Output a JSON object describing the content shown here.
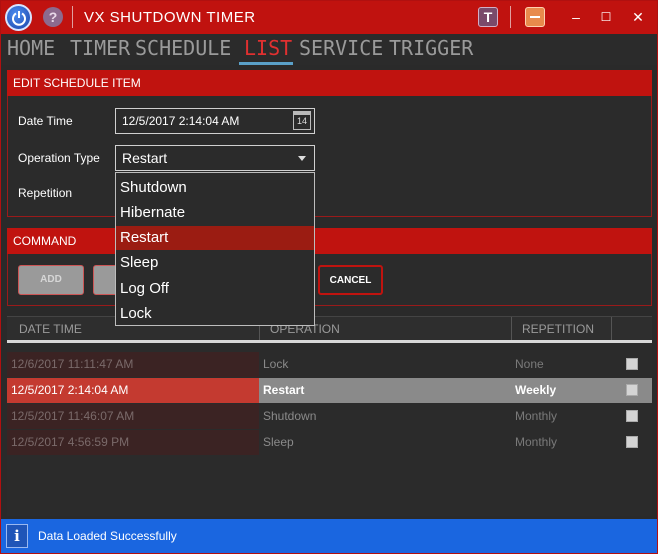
{
  "window": {
    "title": "VX SHUTDOWN TIMER"
  },
  "titlebar": {
    "help_glyph": "?",
    "t_glyph": "T",
    "minimize_glyph": "–",
    "maximize_glyph": "☐",
    "close_glyph": "✕"
  },
  "nav": {
    "items": [
      {
        "label": "HOME"
      },
      {
        "label": "TIMER"
      },
      {
        "label": "SCHEDULE"
      },
      {
        "label": "LIST",
        "active": true
      },
      {
        "label": "SERVICE"
      },
      {
        "label": "TRIGGER"
      }
    ]
  },
  "edit": {
    "heading": "EDIT SCHEDULE ITEM",
    "date_label": "Date Time",
    "date_value": "12/5/2017 2:14:04 AM",
    "calendar_day": "14",
    "op_label": "Operation Type",
    "op_value": "Restart",
    "rep_label": "Repetition"
  },
  "dropdown": {
    "options": [
      "Shutdown",
      "Hibernate",
      "Restart",
      "Sleep",
      "Log Off",
      "Lock"
    ],
    "selected": "Restart"
  },
  "command": {
    "heading": "COMMAND",
    "add_label": "ADD",
    "cancel_label": "CANCEL"
  },
  "table": {
    "columns": [
      "DATE TIME",
      "OPERATION",
      "REPETITION"
    ],
    "rows": [
      {
        "date": "12/6/2017 11:11:47 AM",
        "operation": "Lock",
        "repetition": "None",
        "selected": false
      },
      {
        "date": "12/5/2017 2:14:04 AM",
        "operation": "Restart",
        "repetition": "Weekly",
        "selected": true
      },
      {
        "date": "12/5/2017 11:46:07 AM",
        "operation": "Shutdown",
        "repetition": "Monthly",
        "selected": false
      },
      {
        "date": "12/5/2017 4:56:59 PM",
        "operation": "Sleep",
        "repetition": "Monthly",
        "selected": false
      }
    ]
  },
  "status": {
    "icon": "i",
    "message": "Data Loaded Successfully"
  },
  "colors": {
    "accent": "#c0130f",
    "status_bar": "#1a66e0",
    "tab_active": "#e03030",
    "tab_underline": "#5aa0c8"
  }
}
